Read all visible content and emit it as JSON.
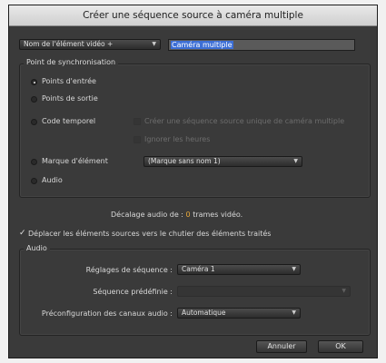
{
  "dialog": {
    "title": "Créer une séquence source à caméra multiple"
  },
  "naming": {
    "dropdown_label": "Nom de l'élément vidéo +",
    "name_value": "Caméra multiple"
  },
  "sync": {
    "legend": "Point de synchronisation",
    "in_points": "Points d'entrée",
    "out_points": "Points de sortie",
    "timecode": "Code temporel",
    "create_single": "Créer une séquence source unique de caméra multiple",
    "ignore_hours": "Ignorer les heures",
    "clip_marker": "Marque d'élément",
    "marker_value": "(Marque sans nom 1)",
    "audio": "Audio"
  },
  "offset": {
    "label": "Décalage audio de :",
    "value": "0",
    "unit": "trames vidéo."
  },
  "move_clips": {
    "label": "Déplacer les éléments sources vers le chutier des éléments traités",
    "checked": true
  },
  "audio_group": {
    "legend": "Audio",
    "seq_settings_label": "Réglages de séquence :",
    "seq_settings_value": "Caméra 1",
    "preset_label": "Séquence prédéfinie :",
    "preset_value": "",
    "channel_label": "Préconfiguration des canaux audio :",
    "channel_value": "Automatique"
  },
  "buttons": {
    "cancel": "Annuler",
    "ok": "OK"
  },
  "colors": {
    "accent": "#e8a93a",
    "selection": "#3d6fd6",
    "panel": "#3a3a3a"
  },
  "icons": {
    "dropdown_arrow": "chevron-down-icon",
    "check": "checkmark-icon"
  }
}
